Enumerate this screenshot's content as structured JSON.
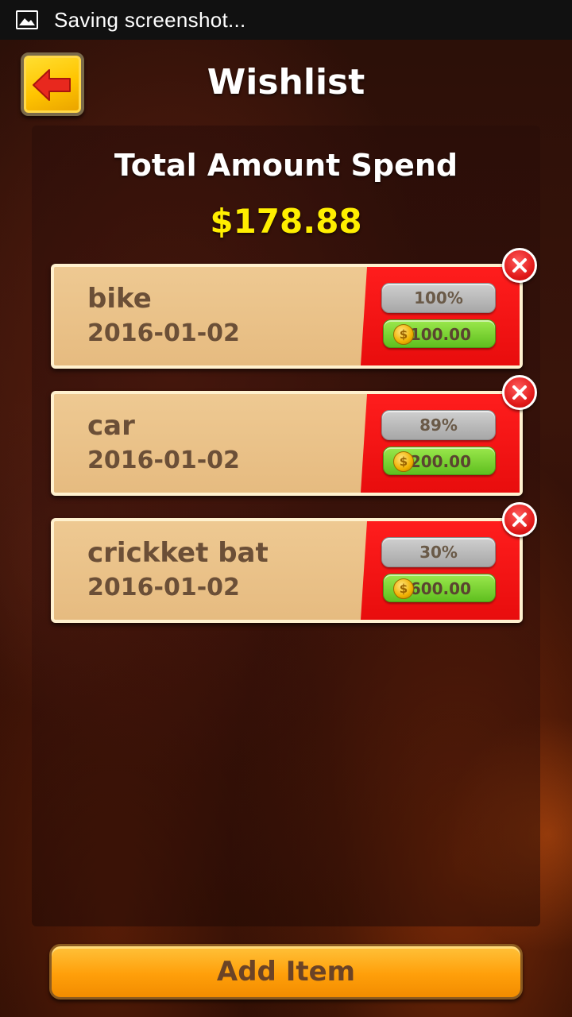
{
  "status_bar": {
    "text": "Saving screenshot..."
  },
  "header": {
    "title": "Wishlist"
  },
  "summary": {
    "label": "Total Amount Spend",
    "value": "$178.88"
  },
  "items": [
    {
      "name": "bike",
      "date": "2016-01-02",
      "percent": "100%",
      "amount": "100.00"
    },
    {
      "name": "car",
      "date": "2016-01-02",
      "percent": "89%",
      "amount": "200.00"
    },
    {
      "name": "crickket bat",
      "date": "2016-01-02",
      "percent": "30%",
      "amount": "600.00"
    }
  ],
  "actions": {
    "add_item": "Add Item"
  },
  "colors": {
    "accent_yellow": "#ffee00",
    "card_red": "#ff1d1d",
    "button_orange": "#ff9f0a",
    "progress_green": "#5fbf1f"
  }
}
